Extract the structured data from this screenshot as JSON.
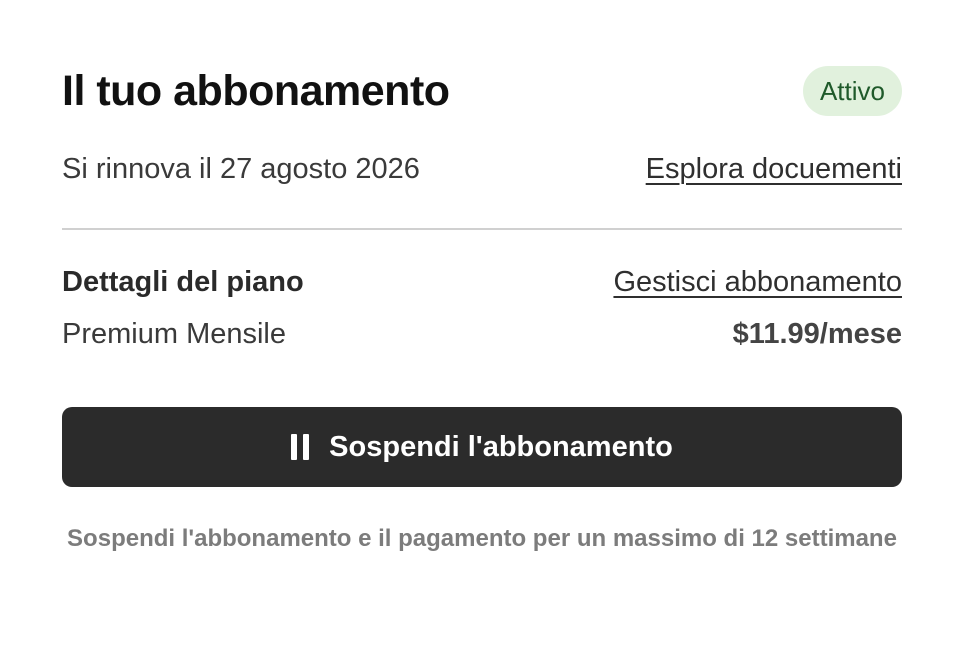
{
  "subscription": {
    "title": "Il tuo abbonamento",
    "status_badge": "Attivo",
    "renewal_text": "Si rinnova il 27 agosto 2026",
    "explore_link": "Esplora docuementi"
  },
  "plan": {
    "details_label": "Dettagli del piano",
    "manage_link": "Gestisci abbonamento",
    "name": "Premium Mensile",
    "price": "$11.99/mese"
  },
  "pause": {
    "button_label": "Sospendi l'abbonamento",
    "icon": "pause-icon",
    "note": "Sospendi l'abbonamento e il pagamento per un massimo di 12 settimane"
  },
  "colors": {
    "badge_bg": "#e1f1dd",
    "badge_text": "#1f5a2a",
    "button_bg": "#2b2b2b",
    "note_text": "#7c7c7c"
  }
}
